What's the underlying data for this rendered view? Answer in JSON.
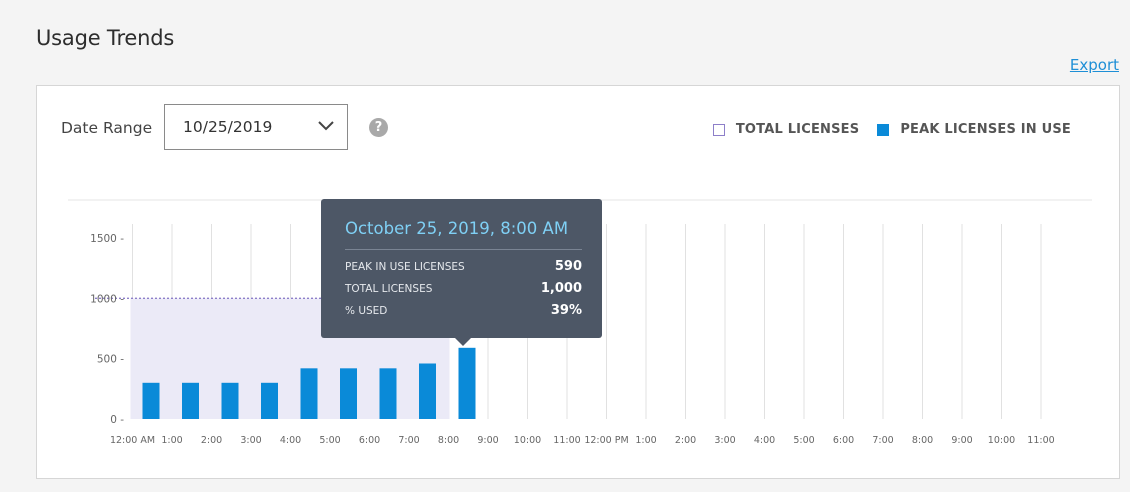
{
  "header": {
    "title": "Usage Trends",
    "export_label": "Export"
  },
  "controls": {
    "date_range_label": "Date Range",
    "date_range_value": "10/25/2019",
    "help_icon": "?"
  },
  "legend": {
    "total": "TOTAL LICENSES",
    "peak": "PEAK LICENSES IN USE"
  },
  "tooltip": {
    "title": "October 25, 2019, 8:00 AM",
    "rows": [
      {
        "label": "PEAK IN USE LICENSES",
        "value": "590"
      },
      {
        "label": "TOTAL LICENSES",
        "value": "1,000"
      },
      {
        "label": "% USED",
        "value": "39%"
      }
    ]
  },
  "colors": {
    "peak": "#0a8ad8",
    "total_fill": "#ebeaf7",
    "total_line": "#8d7fc9",
    "grid": "#e1e1e1",
    "tooltip_bg": "#4d5766",
    "tooltip_title": "#7fd0f5",
    "export_link": "#1e8fd6"
  },
  "chart_data": {
    "type": "bar",
    "categories": [
      "12:00 AM",
      "1:00",
      "2:00",
      "3:00",
      "4:00",
      "5:00",
      "6:00",
      "7:00",
      "8:00",
      "9:00",
      "10:00",
      "11:00",
      "12:00 PM",
      "1:00",
      "2:00",
      "3:00",
      "4:00",
      "5:00",
      "6:00",
      "7:00",
      "8:00",
      "9:00",
      "10:00",
      "11:00"
    ],
    "series": [
      {
        "name": "PEAK LICENSES IN USE",
        "values": [
          300,
          300,
          300,
          300,
          420,
          420,
          420,
          460,
          590
        ]
      },
      {
        "name": "TOTAL LICENSES",
        "values": [
          1000,
          1000,
          1000,
          1000,
          1000,
          1000,
          1000,
          1000,
          1000
        ]
      }
    ],
    "yticks": [
      "0 -",
      "500 -",
      "1000 -",
      "1500 -"
    ],
    "ytick_values": [
      0,
      500,
      1000,
      1500
    ],
    "ylim": [
      0,
      1500
    ],
    "grid": true,
    "legend_position": "top-right"
  }
}
